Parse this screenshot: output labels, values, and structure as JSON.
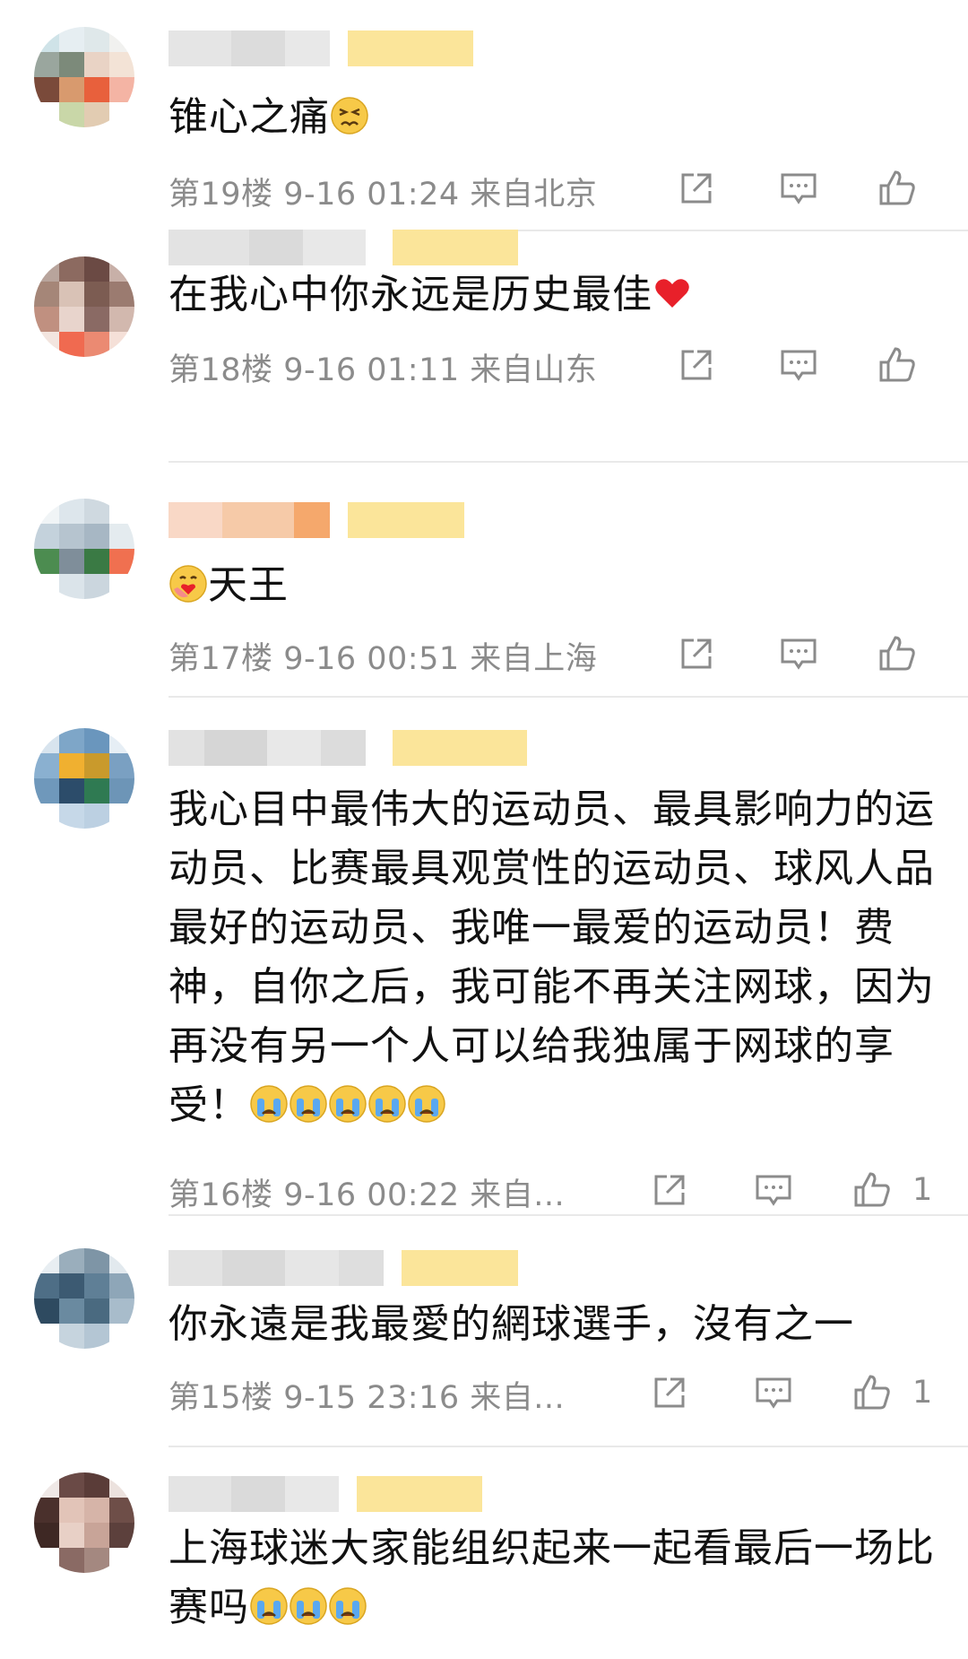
{
  "comments": [
    {
      "text": "锥心之痛",
      "emoji": "persevere",
      "floor": "第19楼",
      "time": "9-16 01:24",
      "location": "来自北京",
      "likes": ""
    },
    {
      "text": "在我心中你永远是历史最佳",
      "emoji": "heart",
      "floor": "第18楼",
      "time": "9-16 01:11",
      "location": "来自山东",
      "likes": ""
    },
    {
      "text": "天王",
      "emoji_before": "hug",
      "floor": "第17楼",
      "time": "9-16 00:51",
      "location": "来自上海",
      "likes": ""
    },
    {
      "text": "我心目中最伟大的运动员、最具影响力的运动员、比赛最具观赏性的运动员、球风人品最好的运动员、我唯一最爱的运动员！费神，自你之后，我可能不再关注网球，因为再没有另一个人可以给我独属于网球的享受！",
      "emoji": "cry x5",
      "floor": "第16楼",
      "time": "9-16 00:22",
      "location": "来自...",
      "likes": "1"
    },
    {
      "text": "你永遠是我最愛的網球選手，沒有之一",
      "floor": "第15楼",
      "time": "9-15 23:16",
      "location": "来自...",
      "likes": "1"
    },
    {
      "text": "上海球迷大家能组织起来一起看最后一场比赛吗",
      "emoji": "cry x3",
      "floor": "",
      "time": "",
      "location": "",
      "likes": ""
    }
  ],
  "icons": {
    "share": "share-icon",
    "comment": "comment-icon",
    "like": "thumbs-up-icon"
  }
}
